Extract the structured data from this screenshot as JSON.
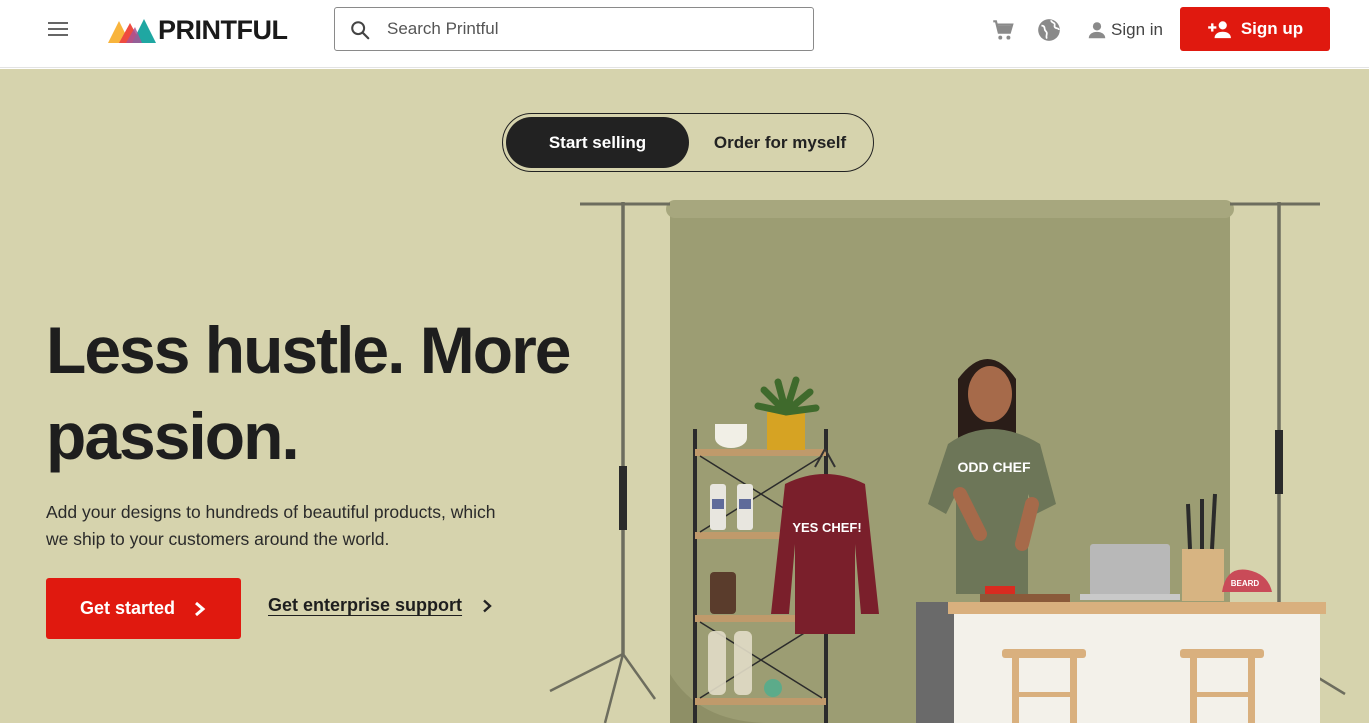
{
  "brand": {
    "name": "PRINTFUL"
  },
  "header": {
    "search_placeholder": "Search Printful",
    "sign_in_label": "Sign in",
    "sign_up_label": "Sign up",
    "icons": [
      "menu-icon",
      "search-icon",
      "cart-icon",
      "globe-icon",
      "user-icon",
      "add-user-icon"
    ]
  },
  "hero": {
    "toggle": {
      "active_label": "Start selling",
      "inactive_label": "Order for myself"
    },
    "headline": "Less hustle. More passion.",
    "subtext": "Add your designs to hundreds of beautiful products, which we ship to your customers around the world.",
    "cta_label": "Get started",
    "secondary_link": "Get enterprise support",
    "image": {
      "sweatshirt_text": "YES CHEF!",
      "tshirt_text": "ODD CHEF",
      "cap_text": "BEARD"
    }
  },
  "colors": {
    "accent": "#e0190f",
    "hero_bg": "#d6d3ad",
    "backdrop": "#9c9d73",
    "text_dark": "#1e1e1e"
  }
}
